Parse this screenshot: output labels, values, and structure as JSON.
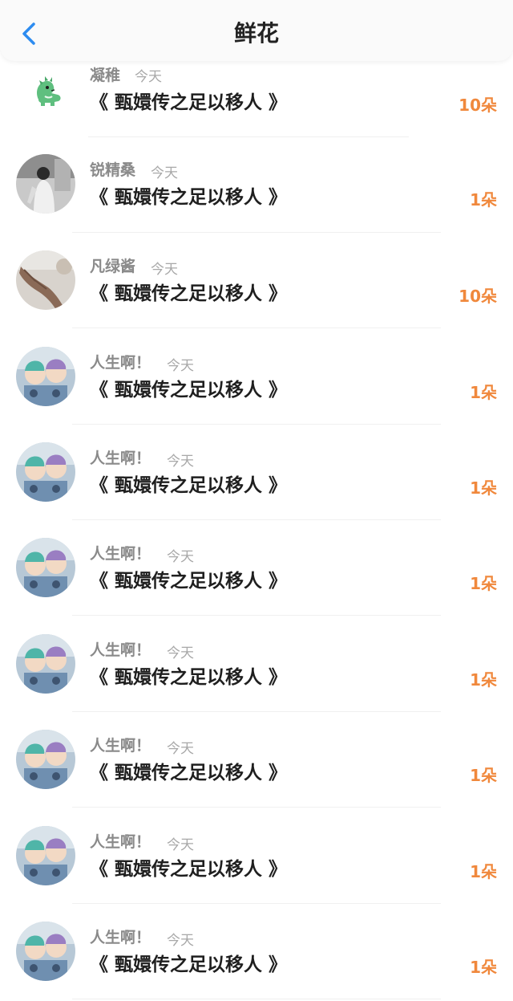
{
  "header": {
    "title": "鲜花"
  },
  "items": [
    {
      "name": "凝稚",
      "time": "今天",
      "work": "《 甄嬛传之足以移人 》",
      "count": "10朵"
    },
    {
      "name": "锐精桑",
      "time": "今天",
      "work": "《 甄嬛传之足以移人 》",
      "count": "1朵"
    },
    {
      "name": "凡绿酱",
      "time": "今天",
      "work": "《 甄嬛传之足以移人 》",
      "count": "10朵"
    },
    {
      "name": "人生啊！",
      "time": "今天",
      "work": "《 甄嬛传之足以移人 》",
      "count": "1朵"
    },
    {
      "name": "人生啊！",
      "time": "今天",
      "work": "《 甄嬛传之足以移人 》",
      "count": "1朵"
    },
    {
      "name": "人生啊！",
      "time": "今天",
      "work": "《 甄嬛传之足以移人 》",
      "count": "1朵"
    },
    {
      "name": "人生啊！",
      "time": "今天",
      "work": "《 甄嬛传之足以移人 》",
      "count": "1朵"
    },
    {
      "name": "人生啊！",
      "time": "今天",
      "work": "《 甄嬛传之足以移人 》",
      "count": "1朵"
    },
    {
      "name": "人生啊！",
      "time": "今天",
      "work": "《 甄嬛传之足以移人 》",
      "count": "1朵"
    },
    {
      "name": "人生啊！",
      "time": "今天",
      "work": "《 甄嬛传之足以移人 》",
      "count": "1朵"
    }
  ],
  "colors": {
    "accent": "#f0883c",
    "back": "#2d8cf0"
  },
  "icons": {
    "back": "chevron-left-icon"
  }
}
